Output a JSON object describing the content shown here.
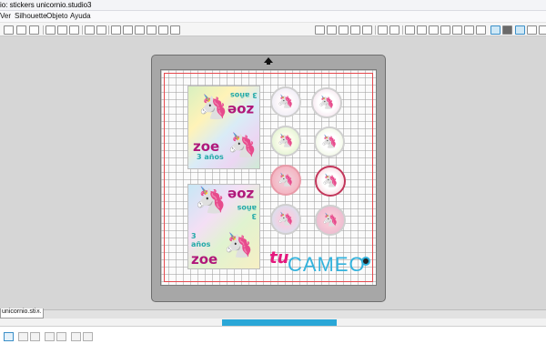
{
  "window": {
    "title": "io: stickers unicornio.studio3"
  },
  "menu": [
    {
      "label": "Ver"
    },
    {
      "label": "Silhouette"
    },
    {
      "label": "Objeto"
    },
    {
      "label": "Ayuda"
    }
  ],
  "document_tab": {
    "label": "unicornio.sti...",
    "close": "×"
  },
  "sticker_sheet": {
    "panel1": {
      "top_text": "3 años",
      "top_name": "zoe",
      "bottom_name": "zoe",
      "bottom_text": "3 años"
    },
    "panel2": {
      "top_name": "zoe",
      "top_text": "3 años",
      "bottom_text": "3 años",
      "bottom_name": "zoe"
    }
  },
  "logo": {
    "prefix": "tu",
    "brand": "CAMEO"
  },
  "colors": {
    "accent": "#2aa7d7",
    "pink": "#e5197e",
    "cut_line": "#e5484d",
    "cameo_blue": "#33b3dd",
    "zoe_text": "#b0187a"
  },
  "icons": {
    "unicorn": "🦄"
  },
  "scroll": {
    "position_fraction": 0.41,
    "visible_fraction": 0.21
  }
}
